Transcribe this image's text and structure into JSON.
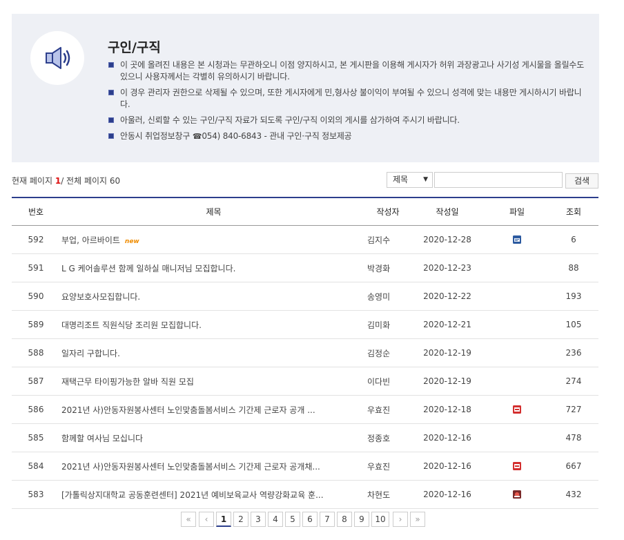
{
  "notice": {
    "title": "구인/구직",
    "items": [
      "이 곳에 올려진 내용은 본 시청과는 무관하오니 이점 양지하시고, 본 게시판을 이용해 게시자가 허위 과장광고나 사기성 게시물을 올릴수도 있으니 사용자께서는 각별히 유의하시기 바랍니다.",
      "이 경우 관리자 권한으로 삭제될 수 있으며, 또한 게시자에게 민,형사상 불이익이 부여될 수 있으니 성격에 맞는 내용만 게시하시기 바랍니다.",
      "아울러, 신뢰할 수 있는 구인/구직 자료가 되도록 구인/구직 이외의 게시를 삼가하여 주시기 바랍니다."
    ],
    "contact_prefix": "안동시 취업정보창구",
    "contact_phone": "054) 840-6843",
    "contact_suffix": " - 관내 구인·구직 정보제공"
  },
  "pageinfo": {
    "label_current": "현재 페이지",
    "current": "1",
    "separator": "/ 전체 페이지",
    "total": "60"
  },
  "search": {
    "field_selected": "제목",
    "input_value": "",
    "button_label": "검색"
  },
  "table": {
    "headers": {
      "num": "번호",
      "title": "제목",
      "author": "작성자",
      "date": "작성일",
      "file": "파일",
      "views": "조회"
    },
    "new_label": "new",
    "rows": [
      {
        "num": "592",
        "title": "부업, 아르바이트",
        "author": "김지수",
        "date": "2020-12-28",
        "file": "hwp-file-icon",
        "views": "6"
      },
      {
        "num": "591",
        "title": "L G 케어솔루션 함께 일하실 매니저님 모집합니다.",
        "author": "박경화",
        "date": "2020-12-23",
        "file": "",
        "views": "88"
      },
      {
        "num": "590",
        "title": "요양보호사모집합니다.",
        "author": "송영미",
        "date": "2020-12-22",
        "file": "",
        "views": "193"
      },
      {
        "num": "589",
        "title": "대명리조트 직원식당 조리원 모집합니다.",
        "author": "김미화",
        "date": "2020-12-21",
        "file": "",
        "views": "105"
      },
      {
        "num": "588",
        "title": "일자리 구합니다.",
        "author": "김정순",
        "date": "2020-12-19",
        "file": "",
        "views": "236"
      },
      {
        "num": "587",
        "title": "재택근무 타이핑가능한 알바 직원 모집",
        "author": "이다빈",
        "date": "2020-12-19",
        "file": "",
        "views": "274"
      },
      {
        "num": "586",
        "title": "2021년 사)안동자원봉사센터 노인맞춤돌봄서비스 기간제 근로자 공개 ...",
        "author": "우효진",
        "date": "2020-12-18",
        "file": "pdf-file-icon",
        "views": "727"
      },
      {
        "num": "585",
        "title": "함께할 여사님 모십니다",
        "author": "정종호",
        "date": "2020-12-16",
        "file": "",
        "views": "478"
      },
      {
        "num": "584",
        "title": "2021년 사)안동자원봉사센터 노인맞춤돌봄서비스 기간제 근로자 공개채...",
        "author": "우효진",
        "date": "2020-12-16",
        "file": "pdf-file-icon",
        "views": "667"
      },
      {
        "num": "583",
        "title": "[가톨릭상지대학교 공동훈련센터] 2021년 예비보육교사 역량강화교육 훈...",
        "author": "차현도",
        "date": "2020-12-16",
        "file": "jpg-file-icon",
        "views": "432"
      }
    ]
  },
  "pager": {
    "first": "«",
    "prev": "‹",
    "pages": [
      "1",
      "2",
      "3",
      "4",
      "5",
      "6",
      "7",
      "8",
      "9",
      "10"
    ],
    "active": "1",
    "next": "›",
    "last": "»"
  },
  "colors": {
    "accent": "#2c3e8c",
    "notice_bg": "#eef0f5",
    "current_page": "#dd1111",
    "new_tag": "#f08c00"
  }
}
